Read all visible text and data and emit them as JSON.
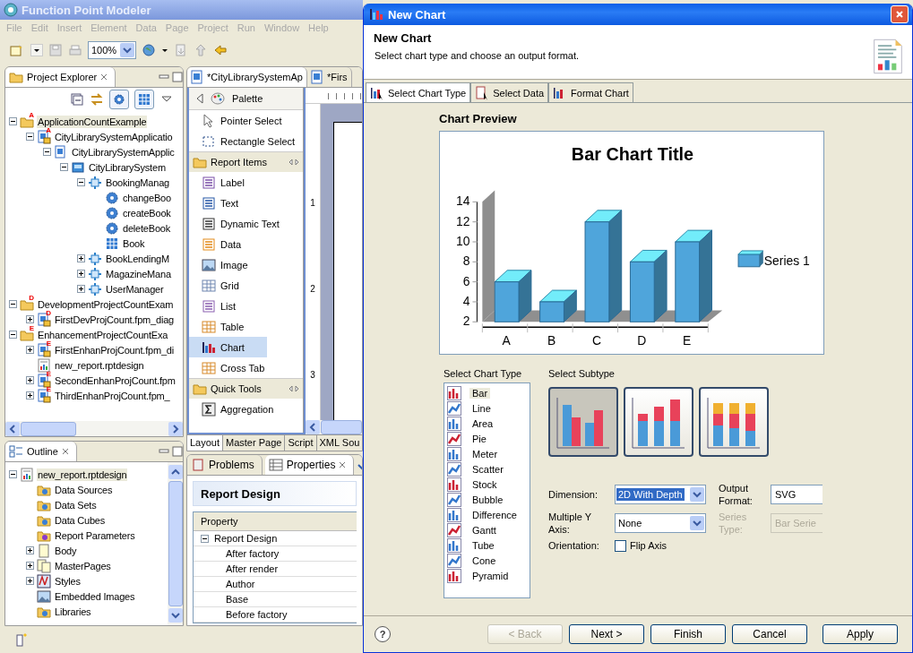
{
  "app": {
    "title": "Function Point Modeler",
    "menu": [
      "File",
      "Edit",
      "Insert",
      "Element",
      "Data",
      "Page",
      "Project",
      "Run",
      "Window",
      "Help"
    ],
    "zoom": "100%"
  },
  "project_explorer": {
    "title": "Project Explorer",
    "tree": [
      {
        "label": "ApplicationCountExample",
        "kind": "folder",
        "badge": "A",
        "expanded": true,
        "selected": true,
        "children": [
          {
            "label": "CityLibrarySystemApplicatio",
            "kind": "fpm-locked",
            "badge": "A",
            "expanded": true,
            "selected": false,
            "children": [
              {
                "label": "CityLibrarySystemApplic",
                "kind": "fpm",
                "expanded": true,
                "selected": false,
                "children": [
                  {
                    "label": "CityLibrarySystem",
                    "kind": "system",
                    "expanded": true,
                    "selected": false,
                    "children": [
                      {
                        "label": "BookingManag",
                        "kind": "component",
                        "expanded": true,
                        "selected": false,
                        "children": [
                          {
                            "label": "changeBoo",
                            "kind": "function",
                            "selected": false
                          },
                          {
                            "label": "createBook",
                            "kind": "function",
                            "selected": false
                          },
                          {
                            "label": "deleteBook",
                            "kind": "function",
                            "selected": false
                          },
                          {
                            "label": "Book",
                            "kind": "entity",
                            "selected": false
                          }
                        ]
                      },
                      {
                        "label": "BookLendingM",
                        "kind": "component",
                        "expanded": false,
                        "selected": false
                      },
                      {
                        "label": "MagazineMana",
                        "kind": "component",
                        "expanded": false,
                        "selected": false
                      },
                      {
                        "label": "UserManager",
                        "kind": "component",
                        "expanded": false,
                        "selected": false
                      }
                    ]
                  }
                ]
              }
            ]
          }
        ]
      },
      {
        "label": "DevelopmentProjectCountExam",
        "kind": "folder",
        "badge": "D",
        "expanded": true,
        "selected": false,
        "children": [
          {
            "label": "FirstDevProjCount.fpm_diag",
            "kind": "fpm-locked",
            "badge": "D",
            "expanded": false,
            "selected": false
          }
        ]
      },
      {
        "label": "EnhancementProjectCountExa",
        "kind": "folder",
        "badge": "E",
        "expanded": true,
        "selected": false,
        "children": [
          {
            "label": "FirstEnhanProjCount.fpm_di",
            "kind": "fpm-locked",
            "badge": "E",
            "expanded": false,
            "selected": false
          },
          {
            "label": "new_report.rptdesign",
            "kind": "report",
            "selected": false
          },
          {
            "label": "SecondEnhanProjCount.fpm",
            "kind": "fpm-locked",
            "badge": "E",
            "expanded": false,
            "selected": false
          },
          {
            "label": "ThirdEnhanProjCount.fpm_",
            "kind": "fpm-locked",
            "badge": "E",
            "expanded": false,
            "selected": false
          }
        ]
      }
    ]
  },
  "editor": {
    "tabs": [
      {
        "label": "*CityLibrarySystemAp",
        "selected": true
      },
      {
        "label": "*Firs",
        "selected": false
      }
    ],
    "palette": {
      "title": "Palette",
      "tools": [
        {
          "label": "Pointer Select",
          "kind": "pointer"
        },
        {
          "label": "Rectangle Select",
          "kind": "marquee"
        }
      ],
      "drawers": [
        {
          "label": "Report Items",
          "items": [
            {
              "label": "Label",
              "kind": "label",
              "selected": false
            },
            {
              "label": "Text",
              "kind": "text",
              "selected": false
            },
            {
              "label": "Dynamic Text",
              "kind": "dynamic-text",
              "selected": false
            },
            {
              "label": "Data",
              "kind": "data",
              "selected": false
            },
            {
              "label": "Image",
              "kind": "image",
              "selected": false
            },
            {
              "label": "Grid",
              "kind": "grid",
              "selected": false
            },
            {
              "label": "List",
              "kind": "list",
              "selected": false
            },
            {
              "label": "Table",
              "kind": "table",
              "selected": false
            },
            {
              "label": "Chart",
              "kind": "chart",
              "selected": true
            },
            {
              "label": "Cross Tab",
              "kind": "crosstab",
              "selected": false
            }
          ]
        },
        {
          "label": "Quick Tools",
          "items": [
            {
              "label": "Aggregation",
              "kind": "aggregation",
              "selected": false
            }
          ]
        }
      ]
    },
    "ruler_marks": [
      "1",
      "2",
      "3"
    ],
    "bottom_tabs": [
      {
        "label": "Layout",
        "selected": true
      },
      {
        "label": "Master Page",
        "selected": false
      },
      {
        "label": "Script",
        "selected": false
      },
      {
        "label": "XML Sou",
        "selected": false
      }
    ]
  },
  "outline": {
    "title": "Outline",
    "tree": [
      {
        "label": "new_report.rptdesign",
        "kind": "report",
        "expanded": true,
        "selected": true,
        "children": [
          {
            "label": "Data Sources",
            "kind": "data-source",
            "selected": false
          },
          {
            "label": "Data Sets",
            "kind": "data-set",
            "selected": false
          },
          {
            "label": "Data Cubes",
            "kind": "data-cube",
            "selected": false
          },
          {
            "label": "Report Parameters",
            "kind": "parameter",
            "selected": false
          },
          {
            "label": "Body",
            "kind": "page",
            "expanded": false,
            "selected": false
          },
          {
            "label": "MasterPages",
            "kind": "pages",
            "expanded": false,
            "selected": false
          },
          {
            "label": "Styles",
            "kind": "styles",
            "expanded": false,
            "selected": false
          },
          {
            "label": "Embedded Images",
            "kind": "image",
            "selected": false
          },
          {
            "label": "Libraries",
            "kind": "library",
            "selected": false
          }
        ]
      }
    ]
  },
  "properties_view": {
    "tabs": [
      {
        "label": "Problems",
        "selected": false
      },
      {
        "label": "Properties",
        "selected": true
      }
    ],
    "heading": "Report Design",
    "column": "Property",
    "group": {
      "label": "Report Design",
      "expanded": true,
      "rows": [
        "After factory",
        "After render",
        "Author",
        "Base",
        "Before factory"
      ]
    }
  },
  "dialog": {
    "title": "New Chart",
    "heading": "New Chart",
    "description": "Select chart type and choose an output format.",
    "tabs": [
      {
        "label": "Select Chart Type",
        "selected": true
      },
      {
        "label": "Select Data",
        "selected": false
      },
      {
        "label": "Format Chart",
        "selected": false
      }
    ],
    "preview_label": "Chart Preview",
    "preview": {
      "chart_data": {
        "type": "bar",
        "title": "Bar Chart Title",
        "categories": [
          "A",
          "B",
          "C",
          "D",
          "E"
        ],
        "series": [
          {
            "name": "Series 1",
            "color": "#4fa5db",
            "values": [
              6,
              4,
              12,
              8,
              10
            ]
          }
        ],
        "ylim": [
          2,
          14
        ],
        "yticks": [
          2,
          4,
          6,
          8,
          10,
          12,
          14
        ]
      }
    },
    "chart_type_label": "Select Chart Type",
    "chart_types": [
      {
        "label": "Bar",
        "selected": true
      },
      {
        "label": "Line",
        "selected": false
      },
      {
        "label": "Area",
        "selected": false
      },
      {
        "label": "Pie",
        "selected": false
      },
      {
        "label": "Meter",
        "selected": false
      },
      {
        "label": "Scatter",
        "selected": false
      },
      {
        "label": "Stock",
        "selected": false
      },
      {
        "label": "Bubble",
        "selected": false
      },
      {
        "label": "Difference",
        "selected": false
      },
      {
        "label": "Gantt",
        "selected": false
      },
      {
        "label": "Tube",
        "selected": false
      },
      {
        "label": "Cone",
        "selected": false
      },
      {
        "label": "Pyramid",
        "selected": false
      }
    ],
    "subtype_label": "Select Subtype",
    "subtypes": [
      {
        "kind": "side_by_side",
        "selected": true
      },
      {
        "kind": "stacked",
        "selected": false
      },
      {
        "kind": "percent_stacked",
        "selected": false
      }
    ],
    "dimension": {
      "label": "Dimension:",
      "value": "2D With Depth",
      "focused": true
    },
    "output_format": {
      "label": "Output Format:",
      "value": "SVG"
    },
    "multiple_y_axis": {
      "label": "Multiple Y Axis:",
      "value": "None"
    },
    "series_type": {
      "label": "Series Type:",
      "value": "Bar Serie",
      "disabled": true
    },
    "orientation": {
      "label": "Orientation:",
      "checkbox": "Flip Axis",
      "checked": false
    },
    "help": "?",
    "buttons": [
      {
        "label": "< Back",
        "disabled": true
      },
      {
        "label": "Next >",
        "disabled": false
      },
      {
        "label": "Finish",
        "disabled": false
      },
      {
        "label": "Cancel",
        "disabled": false
      },
      {
        "label": "Apply",
        "disabled": false
      }
    ]
  }
}
